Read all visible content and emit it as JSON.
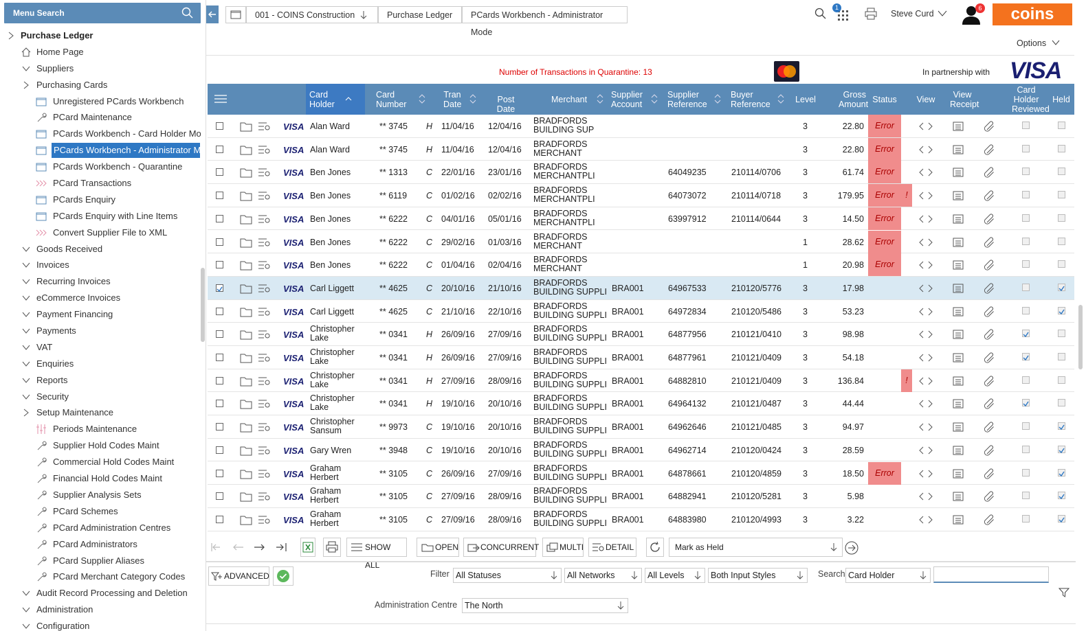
{
  "sidebar": {
    "search_label": "Menu Search",
    "items": [
      {
        "label": "Purchase Ledger",
        "lvl": 0,
        "caret": "right",
        "icon": "",
        "top": true
      },
      {
        "label": "Home Page",
        "lvl": 1,
        "caret": "",
        "icon": "home-icon"
      },
      {
        "label": "Suppliers",
        "lvl": 1,
        "caret": "down",
        "icon": ""
      },
      {
        "label": "Purchasing Cards",
        "lvl": 1,
        "caret": "right",
        "icon": ""
      },
      {
        "label": "Unregistered PCards Workbench",
        "lvl": 2,
        "caret": "",
        "icon": "window-icon"
      },
      {
        "label": "PCard Maintenance",
        "lvl": 2,
        "caret": "",
        "icon": "wrench-icon"
      },
      {
        "label": "PCards Workbench - Card Holder Mo",
        "lvl": 2,
        "caret": "",
        "icon": "window-icon"
      },
      {
        "label": "PCards Workbench - Administrator M",
        "lvl": 2,
        "caret": "",
        "icon": "window-icon",
        "sel": true
      },
      {
        "label": "PCards Workbench - Quarantine",
        "lvl": 2,
        "caret": "",
        "icon": "window-icon"
      },
      {
        "label": "PCard Transactions",
        "lvl": 2,
        "caret": "",
        "icon": "chevrons-icon"
      },
      {
        "label": "PCards Enquiry",
        "lvl": 2,
        "caret": "",
        "icon": "window-icon"
      },
      {
        "label": "PCards Enquiry with Line Items",
        "lvl": 2,
        "caret": "",
        "icon": "window-icon"
      },
      {
        "label": "Convert Supplier File to XML",
        "lvl": 2,
        "caret": "",
        "icon": "chevrons-icon"
      },
      {
        "label": "Goods Received",
        "lvl": 1,
        "caret": "down",
        "icon": ""
      },
      {
        "label": "Invoices",
        "lvl": 1,
        "caret": "down",
        "icon": ""
      },
      {
        "label": "Recurring Invoices",
        "lvl": 1,
        "caret": "down",
        "icon": ""
      },
      {
        "label": "eCommerce Invoices",
        "lvl": 1,
        "caret": "down",
        "icon": ""
      },
      {
        "label": "Payment Financing",
        "lvl": 1,
        "caret": "down",
        "icon": ""
      },
      {
        "label": "Payments",
        "lvl": 1,
        "caret": "down",
        "icon": ""
      },
      {
        "label": "VAT",
        "lvl": 1,
        "caret": "down",
        "icon": ""
      },
      {
        "label": "Enquiries",
        "lvl": 1,
        "caret": "down",
        "icon": ""
      },
      {
        "label": "Reports",
        "lvl": 1,
        "caret": "down",
        "icon": ""
      },
      {
        "label": "Security",
        "lvl": 1,
        "caret": "down",
        "icon": ""
      },
      {
        "label": "Setup Maintenance",
        "lvl": 1,
        "caret": "right",
        "icon": ""
      },
      {
        "label": "Periods Maintenance",
        "lvl": 2,
        "caret": "",
        "icon": "sliders-icon"
      },
      {
        "label": "Supplier Hold Codes Maint",
        "lvl": 2,
        "caret": "",
        "icon": "wrench-icon"
      },
      {
        "label": "Commercial Hold Codes Maint",
        "lvl": 2,
        "caret": "",
        "icon": "wrench-icon"
      },
      {
        "label": "Financial Hold Codes Maint",
        "lvl": 2,
        "caret": "",
        "icon": "wrench-icon"
      },
      {
        "label": "Supplier Analysis Sets",
        "lvl": 2,
        "caret": "",
        "icon": "wrench-icon"
      },
      {
        "label": "PCard Schemes",
        "lvl": 2,
        "caret": "",
        "icon": "wrench-icon"
      },
      {
        "label": "PCard Administration Centres",
        "lvl": 2,
        "caret": "",
        "icon": "wrench-icon"
      },
      {
        "label": "PCard Administrators",
        "lvl": 2,
        "caret": "",
        "icon": "wrench-icon"
      },
      {
        "label": "PCard Supplier Aliases",
        "lvl": 2,
        "caret": "",
        "icon": "wrench-icon"
      },
      {
        "label": "PCard Merchant Category Codes",
        "lvl": 2,
        "caret": "",
        "icon": "wrench-icon"
      },
      {
        "label": "Audit Record Processing and Deletion",
        "lvl": 1,
        "caret": "down",
        "icon": ""
      },
      {
        "label": "Administration",
        "lvl": 1,
        "caret": "down",
        "icon": ""
      },
      {
        "label": "Configuration",
        "lvl": 1,
        "caret": "down",
        "icon": ""
      }
    ]
  },
  "topbar": {
    "crumbs": [
      "001 - COINS Construction",
      "Purchase Ledger",
      "PCards Workbench - Administrator Mode"
    ],
    "user": "Steve Curd",
    "apps_badge": "1",
    "user_badge": "6",
    "logo": "coins",
    "options": "Options"
  },
  "banner": {
    "quarantine": "Number of Transactions in Quarantine: 13",
    "partner": "In partnership with",
    "visa": "VISA",
    "mc_logo": "mastercard-icon"
  },
  "grid": {
    "headers": {
      "card_holder": "Card Holder",
      "card_number": "Card Number",
      "tran_date": "Tran Date",
      "post_date": "Post Date",
      "merchant": "Merchant",
      "supplier_account": "Supplier Account",
      "supplier_reference": "Supplier Reference",
      "buyer_reference": "Buyer Reference",
      "level": "Level",
      "gross_amount": "Gross Amount",
      "status": "Status",
      "view": "View",
      "view_receipt": "View Receipt",
      "ch_reviewed": "Card Holder Reviewed",
      "held": "Held"
    },
    "rows": [
      {
        "sel": false,
        "holder": "Alan Ward",
        "card": "** 3745",
        "type": "H",
        "tran": "11/04/16",
        "post": "12/04/16",
        "merchant": "BRADFORDS BUILDING SUP",
        "account": "",
        "supref": "",
        "buyref": "",
        "level": "3",
        "amount": "22.80",
        "status": "Error",
        "warn": false,
        "reviewed": false,
        "held": false
      },
      {
        "sel": false,
        "holder": "Alan Ward",
        "card": "** 3745",
        "type": "H",
        "tran": "11/04/16",
        "post": "12/04/16",
        "merchant": "BRADFORDS MERCHANT",
        "account": "",
        "supref": "",
        "buyref": "",
        "level": "3",
        "amount": "22.80",
        "status": "Error",
        "warn": false,
        "reviewed": false,
        "held": false
      },
      {
        "sel": false,
        "holder": "Ben Jones",
        "card": "** 1313",
        "type": "C",
        "tran": "22/01/16",
        "post": "23/01/16",
        "merchant": "BRADFORDS MERCHANTPLI",
        "account": "",
        "supref": "64049235",
        "buyref": "210114/0706",
        "level": "3",
        "amount": "61.74",
        "status": "Error",
        "warn": false,
        "reviewed": false,
        "held": false
      },
      {
        "sel": false,
        "holder": "Ben Jones",
        "card": "** 6119",
        "type": "C",
        "tran": "01/02/16",
        "post": "02/02/16",
        "merchant": "BRADFORDS MERCHANTPLI",
        "account": "",
        "supref": "64073072",
        "buyref": "210114/0718",
        "level": "3",
        "amount": "179.95",
        "status": "Error",
        "warn": true,
        "reviewed": false,
        "held": false
      },
      {
        "sel": false,
        "holder": "Ben Jones",
        "card": "** 6222",
        "type": "C",
        "tran": "04/01/16",
        "post": "05/01/16",
        "merchant": "BRADFORDS MERCHANTPLI",
        "account": "",
        "supref": "63997912",
        "buyref": "210114/0644",
        "level": "3",
        "amount": "14.50",
        "status": "Error",
        "warn": false,
        "reviewed": false,
        "held": false
      },
      {
        "sel": false,
        "holder": "Ben Jones",
        "card": "** 6222",
        "type": "C",
        "tran": "29/02/16",
        "post": "01/03/16",
        "merchant": "BRADFORDS MERCHANT",
        "account": "",
        "supref": "",
        "buyref": "",
        "level": "1",
        "amount": "28.62",
        "status": "Error",
        "warn": false,
        "reviewed": false,
        "held": false
      },
      {
        "sel": false,
        "holder": "Ben Jones",
        "card": "** 6222",
        "type": "C",
        "tran": "01/04/16",
        "post": "02/04/16",
        "merchant": "BRADFORDS MERCHANT",
        "account": "",
        "supref": "",
        "buyref": "",
        "level": "1",
        "amount": "20.98",
        "status": "Error",
        "warn": false,
        "reviewed": false,
        "held": false
      },
      {
        "sel": true,
        "holder": "Carl Liggett",
        "card": "** 4625",
        "type": "C",
        "tran": "20/10/16",
        "post": "21/10/16",
        "merchant": "BRADFORDS BUILDING SUPPLI",
        "account": "BRA001",
        "supref": "64967533",
        "buyref": "210120/5776",
        "level": "3",
        "amount": "17.98",
        "status": "",
        "warn": false,
        "reviewed": false,
        "held": true
      },
      {
        "sel": false,
        "holder": "Carl Liggett",
        "card": "** 4625",
        "type": "C",
        "tran": "21/10/16",
        "post": "22/10/16",
        "merchant": "BRADFORDS BUILDING SUPPLI",
        "account": "BRA001",
        "supref": "64972834",
        "buyref": "210120/5486",
        "level": "3",
        "amount": "53.23",
        "status": "",
        "warn": false,
        "reviewed": false,
        "held": true
      },
      {
        "sel": false,
        "holder": "Christopher Lake",
        "card": "** 0341",
        "type": "H",
        "tran": "26/09/16",
        "post": "27/09/16",
        "merchant": "BRADFORDS BUILDING SUPPLI",
        "account": "BRA001",
        "supref": "64877956",
        "buyref": "210121/0410",
        "level": "3",
        "amount": "98.98",
        "status": "",
        "warn": false,
        "reviewed": true,
        "held": false
      },
      {
        "sel": false,
        "holder": "Christopher Lake",
        "card": "** 0341",
        "type": "H",
        "tran": "26/09/16",
        "post": "27/09/16",
        "merchant": "BRADFORDS BUILDING SUPPLI",
        "account": "BRA001",
        "supref": "64877961",
        "buyref": "210121/0409",
        "level": "3",
        "amount": "54.18",
        "status": "",
        "warn": false,
        "reviewed": true,
        "held": false
      },
      {
        "sel": false,
        "holder": "Christopher Lake",
        "card": "** 0341",
        "type": "H",
        "tran": "27/09/16",
        "post": "28/09/16",
        "merchant": "BRADFORDS BUILDING SUPPLI",
        "account": "BRA001",
        "supref": "64882810",
        "buyref": "210121/0409",
        "level": "3",
        "amount": "136.84",
        "status": "",
        "warn": true,
        "reviewed": false,
        "held": false
      },
      {
        "sel": false,
        "holder": "Christopher Lake",
        "card": "** 0341",
        "type": "H",
        "tran": "19/10/16",
        "post": "20/10/16",
        "merchant": "BRADFORDS BUILDING SUPPLI",
        "account": "BRA001",
        "supref": "64964132",
        "buyref": "210121/0487",
        "level": "3",
        "amount": "44.44",
        "status": "",
        "warn": false,
        "reviewed": true,
        "held": false
      },
      {
        "sel": false,
        "holder": "Christopher Sansum",
        "card": "** 9973",
        "type": "C",
        "tran": "19/10/16",
        "post": "20/10/16",
        "merchant": "BRADFORDS BUILDING SUPPLI",
        "account": "BRA001",
        "supref": "64962646",
        "buyref": "210121/0485",
        "level": "3",
        "amount": "94.97",
        "status": "",
        "warn": false,
        "reviewed": false,
        "held": true
      },
      {
        "sel": false,
        "holder": "Gary Wren",
        "card": "** 3948",
        "type": "C",
        "tran": "19/10/16",
        "post": "20/10/16",
        "merchant": "BRADFORDS BUILDING SUPPLI",
        "account": "BRA001",
        "supref": "64962714",
        "buyref": "210120/0424",
        "level": "3",
        "amount": "28.59",
        "status": "",
        "warn": false,
        "reviewed": false,
        "held": true
      },
      {
        "sel": false,
        "holder": "Graham Herbert",
        "card": "** 3105",
        "type": "C",
        "tran": "26/09/16",
        "post": "27/09/16",
        "merchant": "BRADFORDS BUILDING SUPPLI",
        "account": "BRA001",
        "supref": "64878661",
        "buyref": "210120/4859",
        "level": "3",
        "amount": "18.50",
        "status": "Error",
        "warn": false,
        "reviewed": false,
        "held": true
      },
      {
        "sel": false,
        "holder": "Graham Herbert",
        "card": "** 3105",
        "type": "C",
        "tran": "27/09/16",
        "post": "28/09/16",
        "merchant": "BRADFORDS BUILDING SUPPLI",
        "account": "BRA001",
        "supref": "64882941",
        "buyref": "210120/5281",
        "level": "3",
        "amount": "5.98",
        "status": "",
        "warn": false,
        "reviewed": false,
        "held": true
      },
      {
        "sel": false,
        "holder": "Graham Herbert",
        "card": "** 3105",
        "type": "C",
        "tran": "27/09/16",
        "post": "28/09/16",
        "merchant": "BRADFORDS BUILDING SUPPLI",
        "account": "BRA001",
        "supref": "64883980",
        "buyref": "210120/4993",
        "level": "3",
        "amount": "3.22",
        "status": "",
        "warn": false,
        "reviewed": false,
        "held": true
      }
    ],
    "visa": "VISA"
  },
  "toolbar": {
    "show_all": "SHOW ALL",
    "open": "OPEN",
    "concurrent": "CONCURRENT",
    "multi": "MULTI",
    "detail": "DETAIL",
    "action": "Mark as Held"
  },
  "filters": {
    "advanced": "ADVANCED",
    "filter_label": "Filter",
    "status": "All Statuses",
    "network": "All Networks",
    "levels": "All Levels",
    "styles": "Both Input Styles",
    "search_label": "Search",
    "search_field": "Card Holder",
    "search_value": "",
    "admin_label": "Administration Centre",
    "admin_value": "The North"
  },
  "colors": {
    "header": "#5b8bb7",
    "error": "#f08c8c",
    "accent": "#f4721e",
    "selected": "#d9e9f3"
  }
}
